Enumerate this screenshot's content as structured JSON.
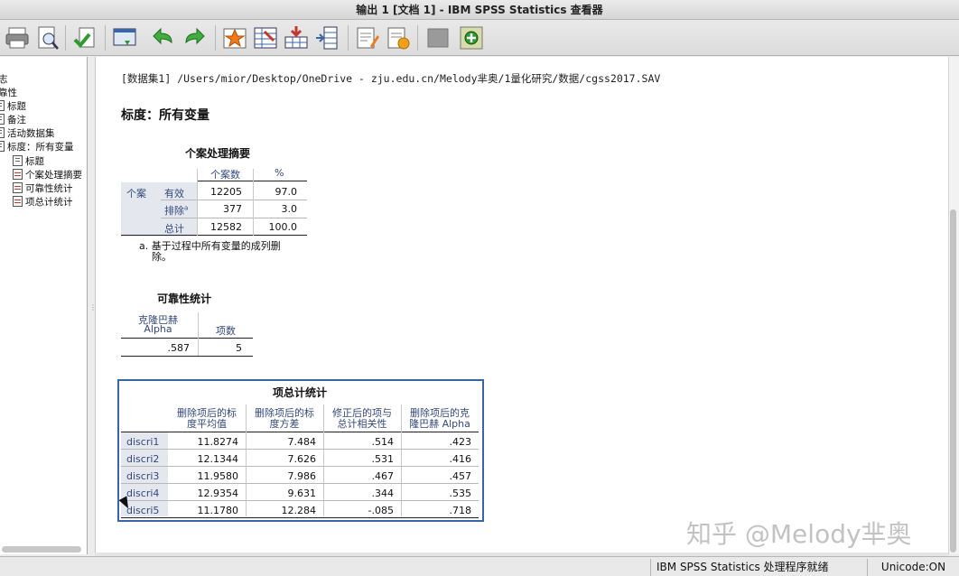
{
  "window": {
    "title": "输出 1 [文档 1] - IBM SPSS Statistics 查看器"
  },
  "toolbar": {
    "buttons": [
      "print-icon",
      "print-preview-icon",
      "export-icon",
      "recall-dialog-icon",
      "undo-icon",
      "redo-icon",
      "goto-data-icon",
      "goto-case-icon",
      "goto-variable-icon",
      "variables-icon",
      "show-output-icon",
      "edit-output-icon",
      "designate-window-icon",
      "add-icon"
    ]
  },
  "outline": {
    "items": [
      {
        "label": "志",
        "type": "root"
      },
      {
        "label": "靠性",
        "type": "root"
      },
      {
        "label": "标题",
        "type": "doc"
      },
      {
        "label": "备注",
        "type": "doc"
      },
      {
        "label": "活动数据集",
        "type": "doc"
      },
      {
        "label": "标度：所有变量",
        "type": "doc"
      },
      {
        "label": "标题",
        "type": "doc"
      },
      {
        "label": "个案处理摘要",
        "type": "tbl"
      },
      {
        "label": "可靠性统计",
        "type": "tbl"
      },
      {
        "label": "项总计统计",
        "type": "tbl"
      }
    ]
  },
  "content": {
    "dataset_path": "[数据集1] /Users/mior/Desktop/OneDrive - zju.edu.cn/Melody芈奥/1量化研究/数据/cgss2017.SAV",
    "scale_heading": "标度：所有变量",
    "case_summary": {
      "title": "个案处理摘要",
      "col_headers": [
        "个案数",
        "%"
      ],
      "group_label": "个案",
      "rows": [
        {
          "label": "有效",
          "sup": "",
          "n": "12205",
          "pct": "97.0"
        },
        {
          "label": "排除",
          "sup": "a",
          "n": "377",
          "pct": "3.0"
        },
        {
          "label": "总计",
          "sup": "",
          "n": "12582",
          "pct": "100.0"
        }
      ],
      "footnote_line1": "a. 基于过程中所有变量的成列删",
      "footnote_line2": "除。"
    },
    "reliability": {
      "title": "可靠性统计",
      "col1_line1": "克隆巴赫",
      "col1_line2": "Alpha",
      "col2": "项数",
      "alpha": ".587",
      "items": "5"
    },
    "item_total": {
      "title": "项总计统计",
      "headers": [
        [
          "删除项后的标",
          "度平均值"
        ],
        [
          "删除项后的标",
          "度方差"
        ],
        [
          "修正后的项与",
          "总计相关性"
        ],
        [
          "删除项后的克",
          "隆巴赫 Alpha"
        ]
      ],
      "rows": [
        {
          "name": "discri1",
          "mean": "11.8274",
          "var": "7.484",
          "corr": ".514",
          "alpha": ".423"
        },
        {
          "name": "discri2",
          "mean": "12.1344",
          "var": "7.626",
          "corr": ".531",
          "alpha": ".416"
        },
        {
          "name": "discri3",
          "mean": "11.9580",
          "var": "7.986",
          "corr": ".467",
          "alpha": ".457"
        },
        {
          "name": "discri4",
          "mean": "12.9354",
          "var": "9.631",
          "corr": ".344",
          "alpha": ".535"
        },
        {
          "name": "discri5",
          "mean": "11.1780",
          "var": "12.284",
          "corr": "-.085",
          "alpha": ".718"
        }
      ]
    }
  },
  "watermark": "知乎 @Melody芈奥",
  "statusbar": {
    "processor": "IBM SPSS Statistics 处理程序就绪",
    "unicode": "Unicode:ON"
  }
}
